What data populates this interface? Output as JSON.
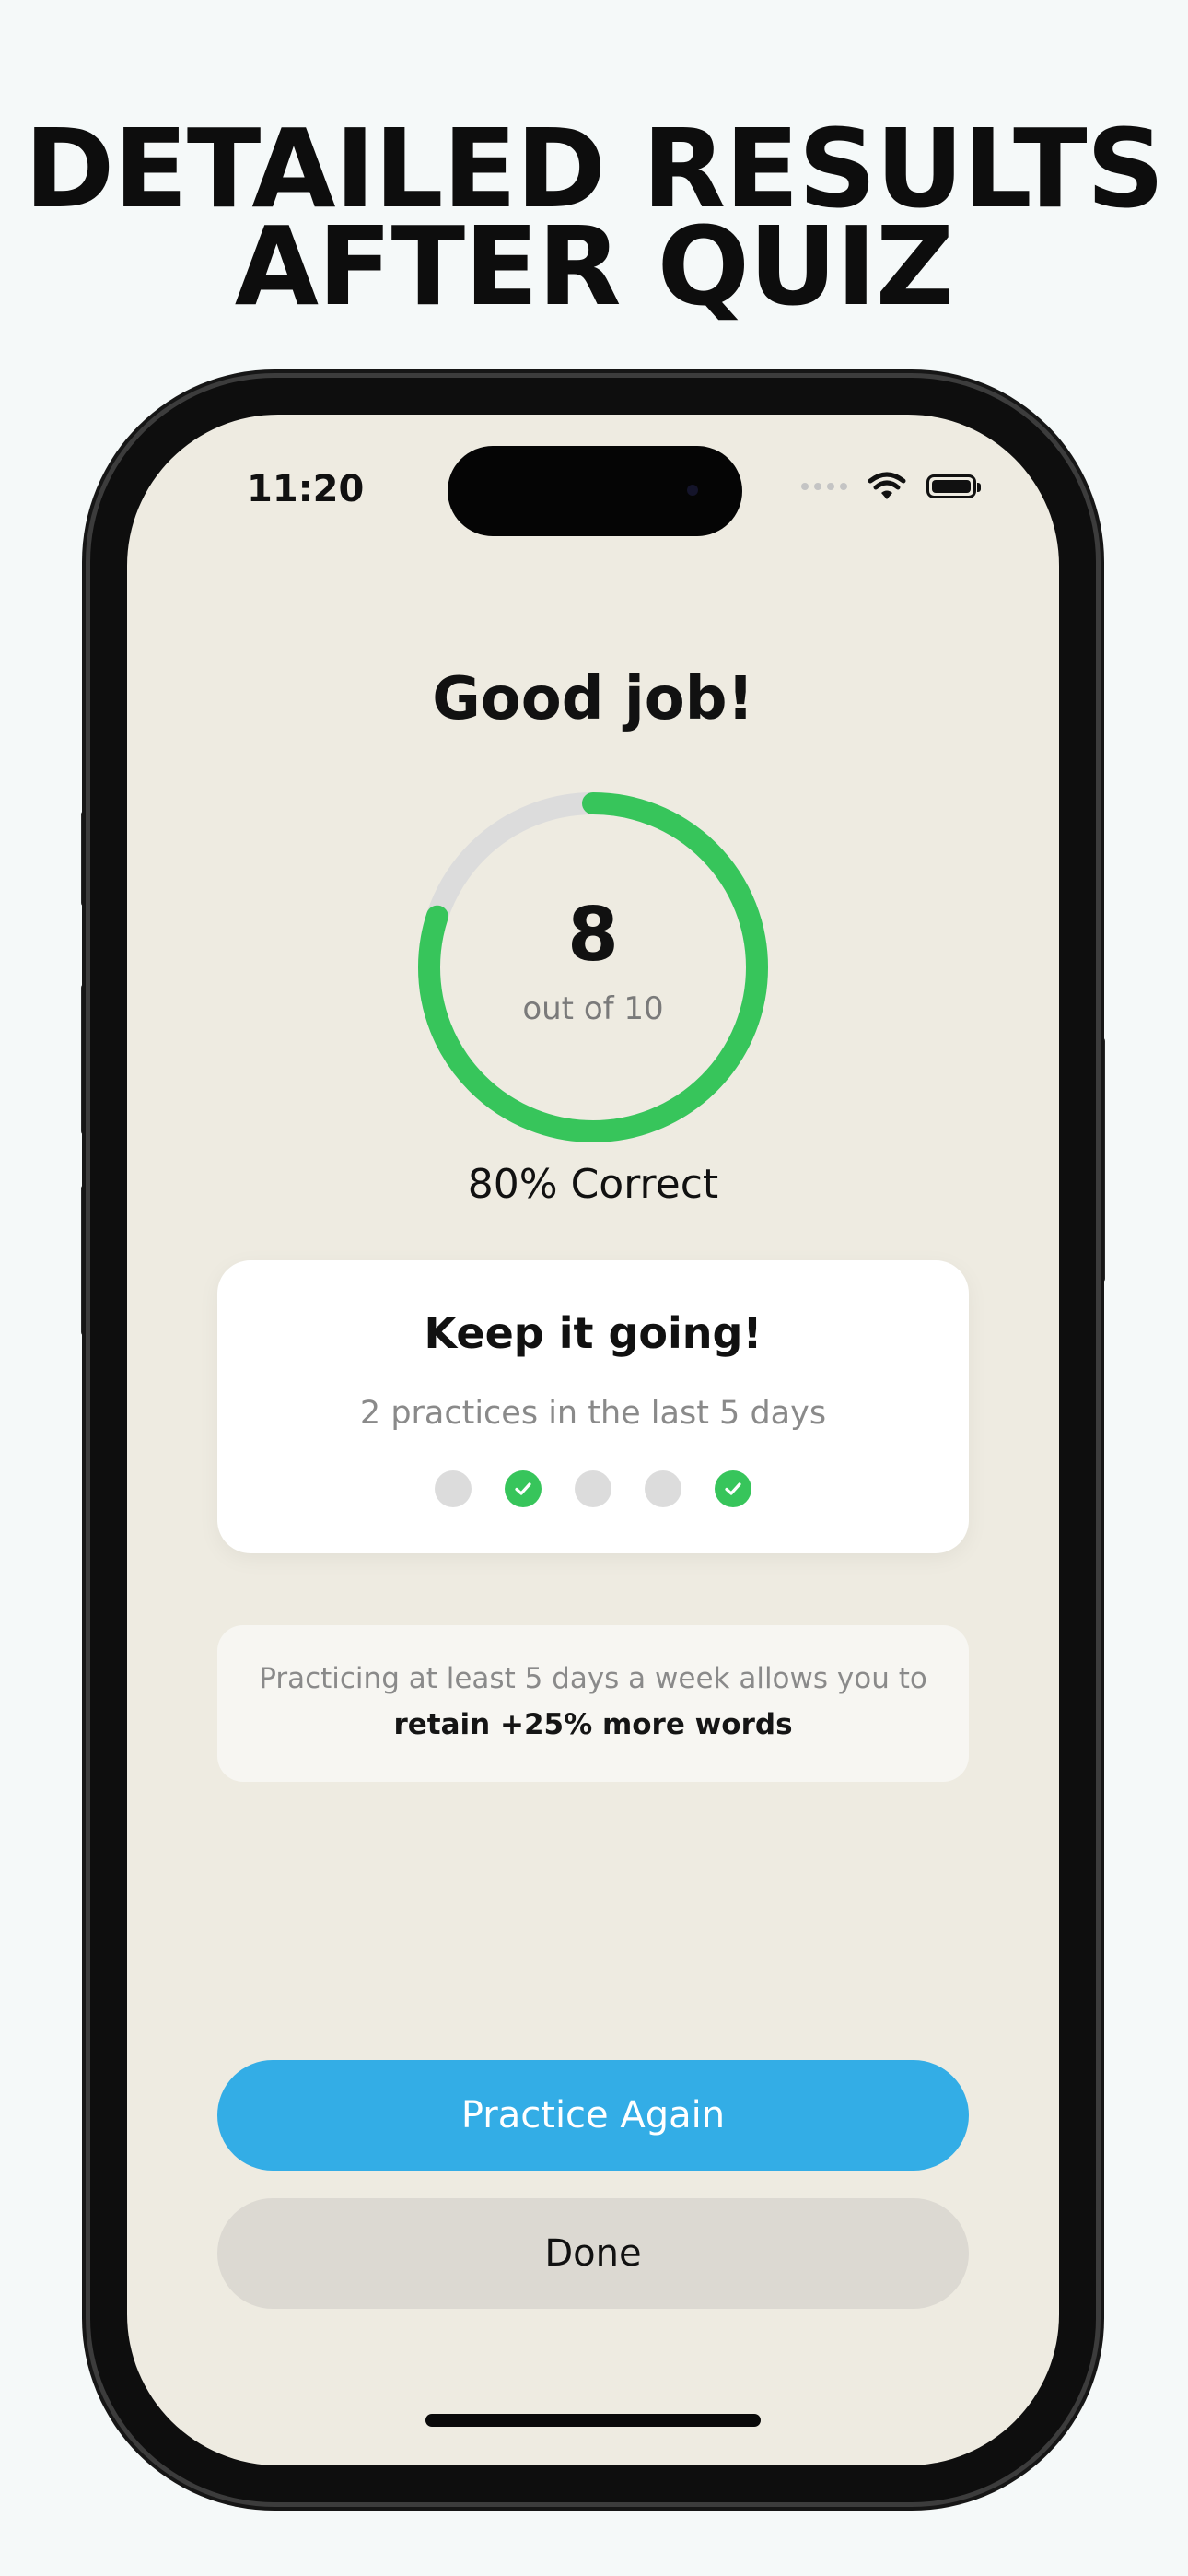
{
  "headline": {
    "line1": "DETAILED RESULTS",
    "line2": "AFTER QUIZ"
  },
  "status_bar": {
    "time": "11:20",
    "icons": [
      "signal-icon",
      "wifi-icon",
      "battery-icon"
    ]
  },
  "results": {
    "title": "Good job!",
    "score": "8",
    "score_sub": "out of 10",
    "percent_label": "80% Correct",
    "progress": 0.8,
    "ring_color": "#37c55b",
    "track_color": "#dcdcdc"
  },
  "streak": {
    "title": "Keep it going!",
    "subtitle": "2 practices in the last 5 days",
    "days": [
      {
        "done": false
      },
      {
        "done": true
      },
      {
        "done": false
      },
      {
        "done": false
      },
      {
        "done": true
      }
    ]
  },
  "tip": {
    "line1": "Practicing at least 5 days a week allows you to",
    "line2": "retain +25% more words"
  },
  "actions": {
    "practice_again": "Practice Again",
    "done": "Done"
  },
  "colors": {
    "primary": "#33ade6",
    "secondary": "#dcd9d2",
    "screen_bg": "#eeebe1",
    "success": "#37c55b"
  }
}
